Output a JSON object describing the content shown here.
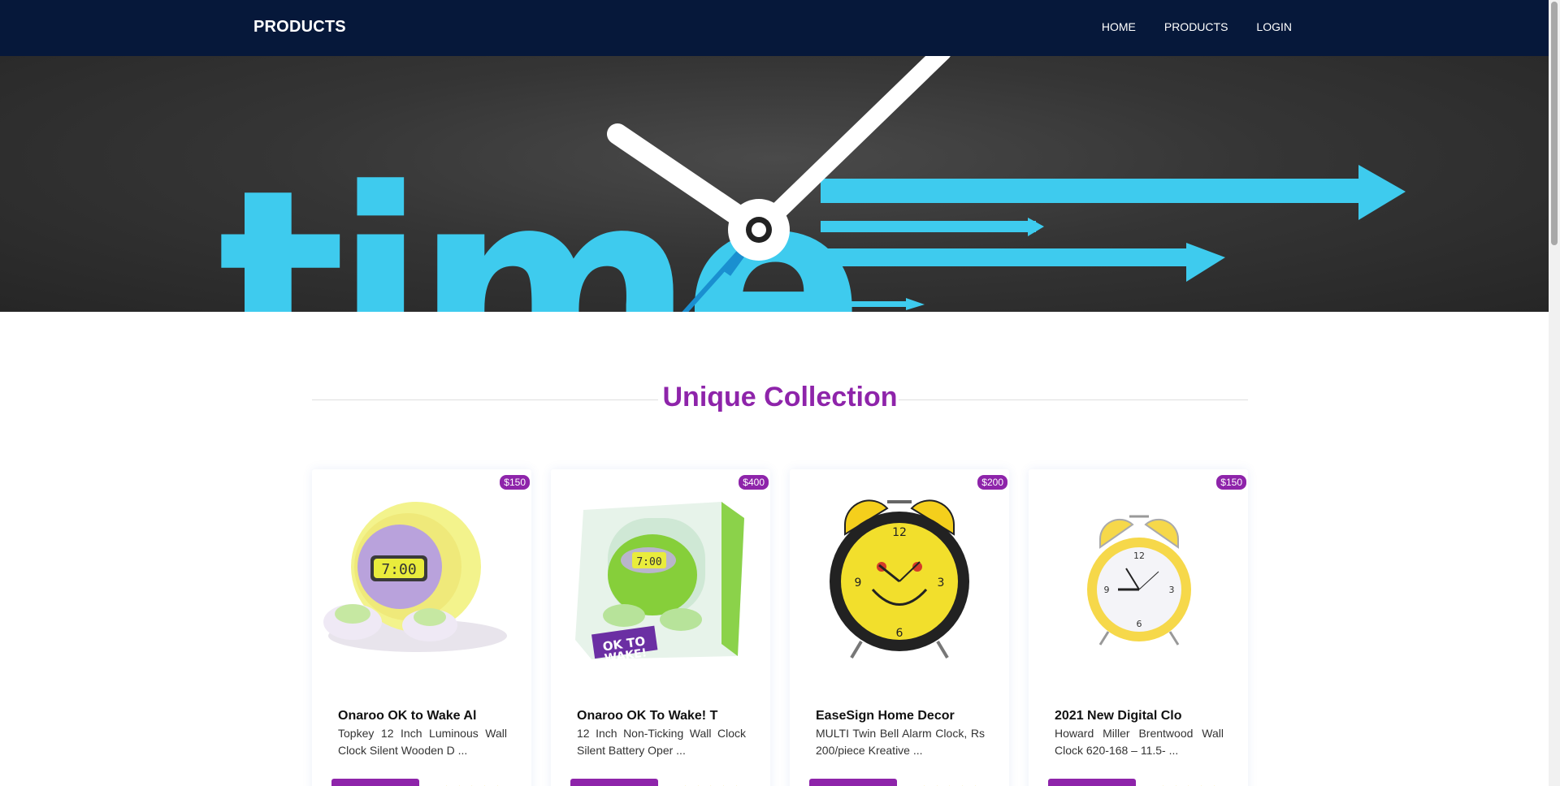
{
  "navbar": {
    "brand": "PRODUCTS",
    "links": [
      "HOME",
      "PRODUCTS",
      "LOGIN"
    ]
  },
  "hero": {
    "word": "time",
    "colors": {
      "text": "#3ecbee",
      "background": "#333333",
      "clock_hands": "#ffffff"
    }
  },
  "section": {
    "title": "Unique Collection",
    "title_color": "#8e24aa"
  },
  "products": [
    {
      "price": "$150",
      "title": "Onaroo OK to Wake Al",
      "desc": "Topkey 12 Inch Luminous Wall Clock Silent Wooden D ...",
      "image": "onaroo-globe-clock"
    },
    {
      "price": "$400",
      "title": "Onaroo OK To Wake! T",
      "desc": "12 Inch Non-Ticking Wall Clock Silent Battery Oper ...",
      "image": "onaroo-boxed-clock"
    },
    {
      "price": "$200",
      "title": "EaseSign Home Decor",
      "desc": "MULTI Twin Bell Alarm Clock, Rs 200/piece Kreative ...",
      "image": "smiley-alarm-clock"
    },
    {
      "price": "$150",
      "title": "2021 New Digital Clo",
      "desc": "Howard Miller Brentwood Wall Clock 620-168 – 11.5- ...",
      "image": "yellow-twin-bell-clock"
    }
  ],
  "accent_color": "#8e24aa",
  "nav_color": "#06183a"
}
